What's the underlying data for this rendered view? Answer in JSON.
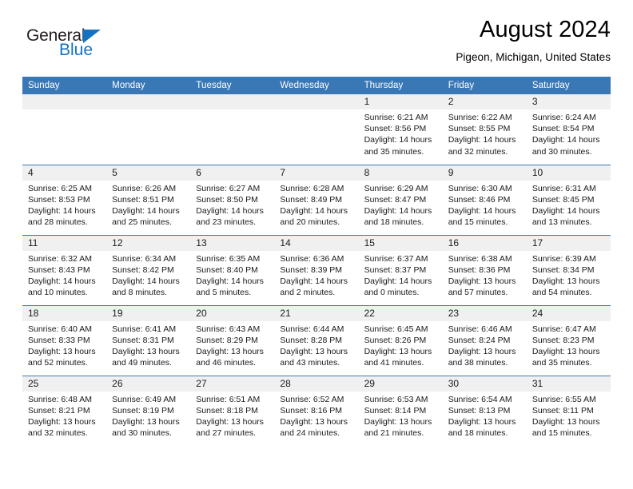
{
  "brand": {
    "name_top": "General",
    "name_bottom": "Blue",
    "triangle_color": "#1273c4"
  },
  "header": {
    "title": "August 2024",
    "subtitle": "Pigeon, Michigan, United States"
  },
  "theme": {
    "header_blue": "#3a78b5",
    "daynum_band": "#f0f0f0",
    "text": "#1a1a1a"
  },
  "weekday_headers": [
    "Sunday",
    "Monday",
    "Tuesday",
    "Wednesday",
    "Thursday",
    "Friday",
    "Saturday"
  ],
  "weeks": [
    [
      {
        "day": "",
        "details": ""
      },
      {
        "day": "",
        "details": ""
      },
      {
        "day": "",
        "details": ""
      },
      {
        "day": "",
        "details": ""
      },
      {
        "day": "1",
        "details": "Sunrise: 6:21 AM\nSunset: 8:56 PM\nDaylight: 14 hours\nand 35 minutes."
      },
      {
        "day": "2",
        "details": "Sunrise: 6:22 AM\nSunset: 8:55 PM\nDaylight: 14 hours\nand 32 minutes."
      },
      {
        "day": "3",
        "details": "Sunrise: 6:24 AM\nSunset: 8:54 PM\nDaylight: 14 hours\nand 30 minutes."
      }
    ],
    [
      {
        "day": "4",
        "details": "Sunrise: 6:25 AM\nSunset: 8:53 PM\nDaylight: 14 hours\nand 28 minutes."
      },
      {
        "day": "5",
        "details": "Sunrise: 6:26 AM\nSunset: 8:51 PM\nDaylight: 14 hours\nand 25 minutes."
      },
      {
        "day": "6",
        "details": "Sunrise: 6:27 AM\nSunset: 8:50 PM\nDaylight: 14 hours\nand 23 minutes."
      },
      {
        "day": "7",
        "details": "Sunrise: 6:28 AM\nSunset: 8:49 PM\nDaylight: 14 hours\nand 20 minutes."
      },
      {
        "day": "8",
        "details": "Sunrise: 6:29 AM\nSunset: 8:47 PM\nDaylight: 14 hours\nand 18 minutes."
      },
      {
        "day": "9",
        "details": "Sunrise: 6:30 AM\nSunset: 8:46 PM\nDaylight: 14 hours\nand 15 minutes."
      },
      {
        "day": "10",
        "details": "Sunrise: 6:31 AM\nSunset: 8:45 PM\nDaylight: 14 hours\nand 13 minutes."
      }
    ],
    [
      {
        "day": "11",
        "details": "Sunrise: 6:32 AM\nSunset: 8:43 PM\nDaylight: 14 hours\nand 10 minutes."
      },
      {
        "day": "12",
        "details": "Sunrise: 6:34 AM\nSunset: 8:42 PM\nDaylight: 14 hours\nand 8 minutes."
      },
      {
        "day": "13",
        "details": "Sunrise: 6:35 AM\nSunset: 8:40 PM\nDaylight: 14 hours\nand 5 minutes."
      },
      {
        "day": "14",
        "details": "Sunrise: 6:36 AM\nSunset: 8:39 PM\nDaylight: 14 hours\nand 2 minutes."
      },
      {
        "day": "15",
        "details": "Sunrise: 6:37 AM\nSunset: 8:37 PM\nDaylight: 14 hours\nand 0 minutes."
      },
      {
        "day": "16",
        "details": "Sunrise: 6:38 AM\nSunset: 8:36 PM\nDaylight: 13 hours\nand 57 minutes."
      },
      {
        "day": "17",
        "details": "Sunrise: 6:39 AM\nSunset: 8:34 PM\nDaylight: 13 hours\nand 54 minutes."
      }
    ],
    [
      {
        "day": "18",
        "details": "Sunrise: 6:40 AM\nSunset: 8:33 PM\nDaylight: 13 hours\nand 52 minutes."
      },
      {
        "day": "19",
        "details": "Sunrise: 6:41 AM\nSunset: 8:31 PM\nDaylight: 13 hours\nand 49 minutes."
      },
      {
        "day": "20",
        "details": "Sunrise: 6:43 AM\nSunset: 8:29 PM\nDaylight: 13 hours\nand 46 minutes."
      },
      {
        "day": "21",
        "details": "Sunrise: 6:44 AM\nSunset: 8:28 PM\nDaylight: 13 hours\nand 43 minutes."
      },
      {
        "day": "22",
        "details": "Sunrise: 6:45 AM\nSunset: 8:26 PM\nDaylight: 13 hours\nand 41 minutes."
      },
      {
        "day": "23",
        "details": "Sunrise: 6:46 AM\nSunset: 8:24 PM\nDaylight: 13 hours\nand 38 minutes."
      },
      {
        "day": "24",
        "details": "Sunrise: 6:47 AM\nSunset: 8:23 PM\nDaylight: 13 hours\nand 35 minutes."
      }
    ],
    [
      {
        "day": "25",
        "details": "Sunrise: 6:48 AM\nSunset: 8:21 PM\nDaylight: 13 hours\nand 32 minutes."
      },
      {
        "day": "26",
        "details": "Sunrise: 6:49 AM\nSunset: 8:19 PM\nDaylight: 13 hours\nand 30 minutes."
      },
      {
        "day": "27",
        "details": "Sunrise: 6:51 AM\nSunset: 8:18 PM\nDaylight: 13 hours\nand 27 minutes."
      },
      {
        "day": "28",
        "details": "Sunrise: 6:52 AM\nSunset: 8:16 PM\nDaylight: 13 hours\nand 24 minutes."
      },
      {
        "day": "29",
        "details": "Sunrise: 6:53 AM\nSunset: 8:14 PM\nDaylight: 13 hours\nand 21 minutes."
      },
      {
        "day": "30",
        "details": "Sunrise: 6:54 AM\nSunset: 8:13 PM\nDaylight: 13 hours\nand 18 minutes."
      },
      {
        "day": "31",
        "details": "Sunrise: 6:55 AM\nSunset: 8:11 PM\nDaylight: 13 hours\nand 15 minutes."
      }
    ]
  ]
}
